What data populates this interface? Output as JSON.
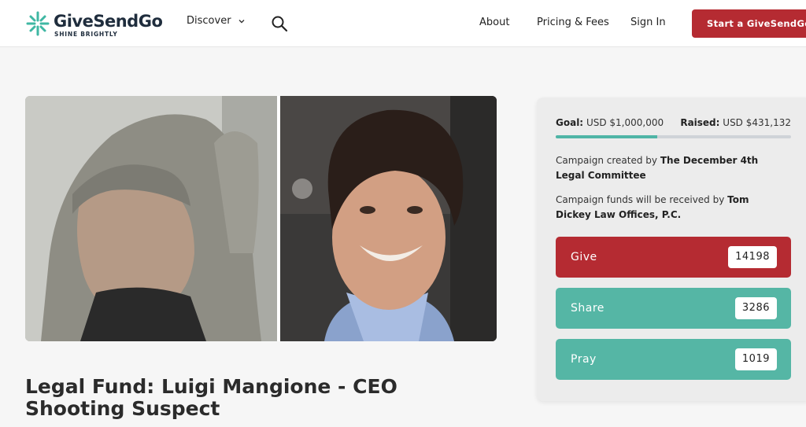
{
  "brand": {
    "name": "GiveSendGo",
    "tagline": "SHINE BRIGHTLY",
    "accent": "#b52b32",
    "teal": "#55b6a5"
  },
  "nav": {
    "discover": "Discover",
    "about": "About",
    "pricing": "Pricing & Fees",
    "signin": "Sign In",
    "start": "Start a GiveSendGo"
  },
  "campaign": {
    "title": "Legal Fund: Luigi Mangione - CEO Shooting Suspect",
    "goal_label": "Goal:",
    "goal_value": "USD $1,000,000",
    "raised_label": "Raised:",
    "raised_value": "USD $431,132",
    "progress_fraction": 0.431,
    "created_prefix": "Campaign created by",
    "created_by": "The December 4th Legal Committee",
    "funds_prefix": "Campaign funds will be received by",
    "funds_to": "Tom Dickey Law Offices, P.C."
  },
  "actions": {
    "give": {
      "label": "Give",
      "count": "14198"
    },
    "share": {
      "label": "Share",
      "count": "3286"
    },
    "pray": {
      "label": "Pray",
      "count": "1019"
    }
  },
  "icons": {
    "logo": "givesendgo-star-icon",
    "discover_chevron": "chevron-down-icon",
    "search": "search-icon"
  }
}
